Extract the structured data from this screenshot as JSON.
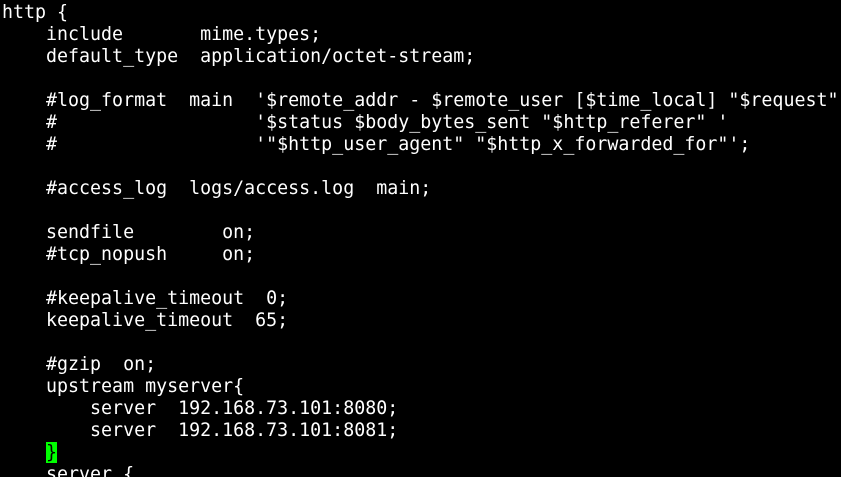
{
  "terminal": {
    "lines": [
      "http {",
      "    include       mime.types;",
      "    default_type  application/octet-stream;",
      "",
      "    #log_format  main  '$remote_addr - $remote_user [$time_local] \"$request\"",
      "    #                  '$status $body_bytes_sent \"$http_referer\" '",
      "    #                  '\"$http_user_agent\" \"$http_x_forwarded_for\"';",
      "",
      "    #access_log  logs/access.log  main;",
      "",
      "    sendfile        on;",
      "    #tcp_nopush     on;",
      "",
      "    #keepalive_timeout  0;",
      "    keepalive_timeout  65;",
      "",
      "    #gzip  on;",
      "    upstream myserver{",
      "        server  192.168.73.101:8080;",
      "        server  192.168.73.101:8081;",
      "",
      "    server {"
    ],
    "cursor": {
      "indent": "    ",
      "char": "}"
    },
    "colors": {
      "background": "#000000",
      "foreground": "#ffffff",
      "cursor": "#00ff00"
    }
  }
}
